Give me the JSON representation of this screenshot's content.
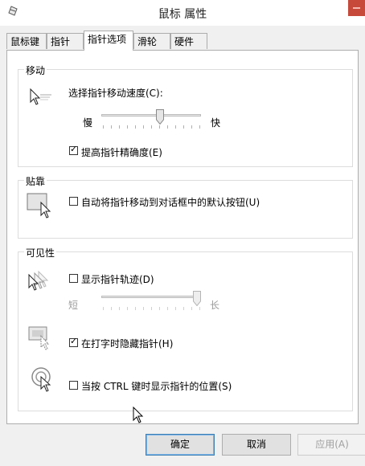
{
  "window": {
    "title": "鼠标 属性"
  },
  "tabs": [
    {
      "label": "鼠标键",
      "active": false
    },
    {
      "label": "指针",
      "active": false
    },
    {
      "label": "指针选项",
      "active": true
    },
    {
      "label": "滑轮",
      "active": false
    },
    {
      "label": "硬件",
      "active": false
    }
  ],
  "motion": {
    "group_label": "移动",
    "speed_label": "选择指针移动速度(C):",
    "slow_label": "慢",
    "fast_label": "快",
    "speed_value": 0.6,
    "precision_label": "提高指针精确度(E)",
    "precision_checked": true
  },
  "snap": {
    "group_label": "贴靠",
    "snap_label": "自动将指针移动到对话框中的默认按钮(U)",
    "snap_checked": false
  },
  "visibility": {
    "group_label": "可见性",
    "trails_label": "显示指针轨迹(D)",
    "trails_checked": false,
    "short_label": "短",
    "long_label": "长",
    "trails_value": 1.0,
    "hide_label": "在打字时隐藏指针(H)",
    "hide_checked": true,
    "ctrl_label": "当按 CTRL 键时显示指针的位置(S)",
    "ctrl_checked": false
  },
  "buttons": {
    "ok": "确定",
    "cancel": "取消",
    "apply": "应用(A)"
  },
  "colors": {
    "close_button": "#c7493a",
    "default_button_border": "#3c7fb1"
  }
}
